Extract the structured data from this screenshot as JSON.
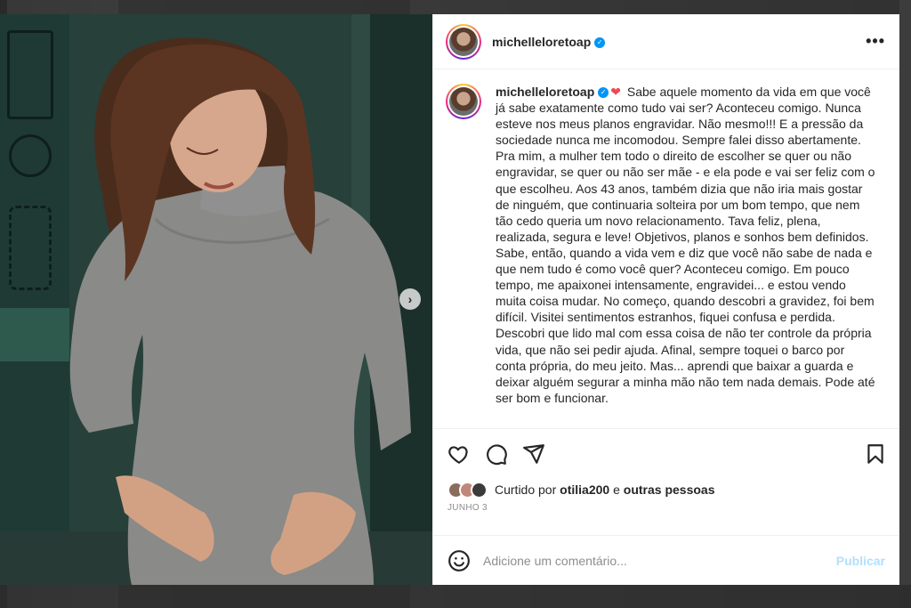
{
  "post": {
    "username": "michelleloretoap",
    "verified_mark": "✓",
    "more_icon": "•••",
    "caption": "Sabe aquele momento da vida em que você já sabe exatamente como tudo vai ser? Aconteceu comigo. Nunca esteve nos meus planos engravidar. Não mesmo!!! E a pressão da sociedade nunca me incomodou. Sempre falei disso abertamente. Pra mim, a mulher tem todo o direito de escolher se quer ou não engravidar, se quer ou não ser mãe - e ela pode e vai ser feliz com o que escolheu. Aos 43 anos, também dizia que não iria mais gostar de ninguém, que continuaria solteira por um bom tempo, que nem tão cedo queria um novo relacionamento. Tava feliz, plena, realizada, segura e leve! Objetivos, planos e sonhos bem definidos.",
    "caption_p2": "Sabe, então, quando a vida vem e diz que você não sabe de nada e que nem tudo é como você quer? Aconteceu comigo. Em pouco tempo, me apaixonei intensamente, engravidei... e estou vendo muita coisa mudar. No começo, quando descobri a gravidez, foi bem difícil. Visitei sentimentos estranhos, fiquei confusa e perdida. Descobri que lido mal com essa coisa de não ter controle da própria vida, que não sei pedir ajuda. Afinal, sempre toquei o barco por conta própria, do meu jeito. Mas... aprendi que baixar a guarda e deixar alguém segurar a minha mão não tem nada demais. Pode até ser bom e funcionar.",
    "heart": "❤",
    "likes_prefix": "Curtido por",
    "likes_user": "otilia200",
    "likes_conj": "e",
    "likes_others": "outras pessoas",
    "date": "JUNHO 3"
  },
  "media": {
    "next_arrow": "›"
  },
  "actions": {
    "like": "heart-icon",
    "comment": "comment-icon",
    "share": "share-icon",
    "save": "bookmark-icon"
  },
  "comment": {
    "placeholder": "Adicione um comentário...",
    "publish_label": "Publicar"
  },
  "colors": {
    "verified": "#0095f6",
    "heart": "#ed4956",
    "publish_disabled": "#b2dffc"
  }
}
